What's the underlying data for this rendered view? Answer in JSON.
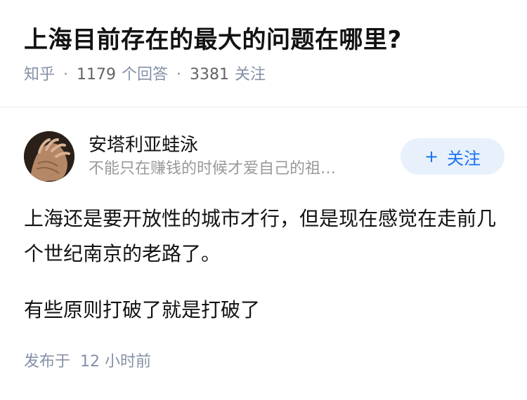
{
  "question": {
    "title": "上海目前存在的最大的问题在哪里?",
    "source": "知乎",
    "answers_count": "1179",
    "answers_label": "个回答",
    "followers_count": "3381",
    "followers_label": "关注"
  },
  "answer": {
    "author": {
      "name": "安塔利亚蛙泳",
      "bio": "不能只在赚钱的时候才爱自己的祖…",
      "avatar_icon": "hand-photo"
    },
    "follow_button": {
      "plus": "+",
      "label": "关注"
    },
    "paragraphs": [
      "上海还是要开放性的城市才行，但是现在感觉在走前几个世纪南京的老路了。",
      "有些原则打破了就是打破了"
    ],
    "published_label": "发布于",
    "published_time": "12 小时前"
  },
  "colors": {
    "meta_gray": "#8590a6",
    "accent_blue": "#1772f6",
    "button_bg": "#e8f1fb"
  }
}
